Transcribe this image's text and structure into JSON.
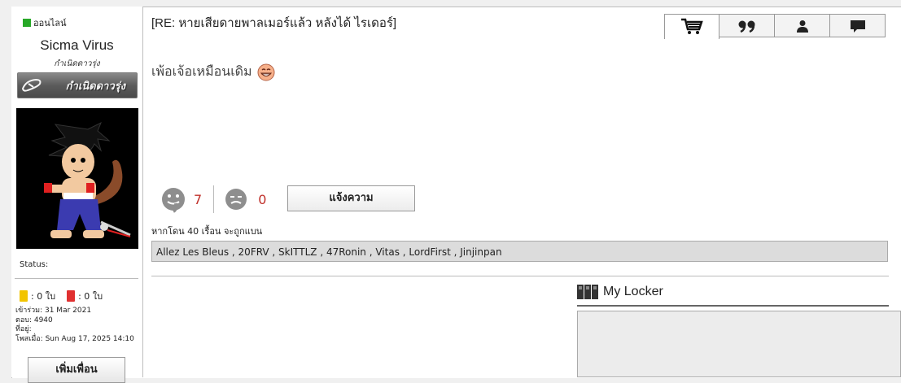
{
  "sidebar": {
    "online_label": "ออนไลน์",
    "username": "Sicma Virus",
    "rank_title": "กำเนิดดาวรุ่ง",
    "rank_badge": "กำเนิดดาวรุ่ง",
    "status_label": "Status:",
    "yellow_cards": ": 0 ใบ",
    "red_cards": ": 0 ใบ",
    "joined": "เข้าร่วม: 31 Mar 2021",
    "replies": "ตอบ: 4940",
    "location": "ที่อยู่:",
    "posted": "โพสเมื่อ: Sun Aug 17, 2025 14:10",
    "add_friend": "เพิ่มเพื่อน",
    "colors": {
      "online": "#27a827",
      "yellow": "#f2c400",
      "red": "#e03030"
    }
  },
  "post": {
    "title": "[RE: หายเสียดายพาลเมอร์แล้ว หลังได้ ไรเดอร์]",
    "message": "เพ้อเจ้อเหมือนเดิม",
    "likes": "7",
    "dislikes": "0",
    "report_button": "แจ้งความ",
    "ban_notice": "หากโดน 40 เรื้อน จะถูกแบน",
    "likers": "Allez Les Bleus , 20FRV , SkITTLZ , 47Ronin , Vitas , LordFirst , Jinjinpan",
    "vote_color": "#c0302a"
  },
  "toolbar": {
    "icons": [
      "cart-icon",
      "quote-icon",
      "user-icon",
      "comment-icon"
    ]
  },
  "locker": {
    "title": "My Locker"
  }
}
